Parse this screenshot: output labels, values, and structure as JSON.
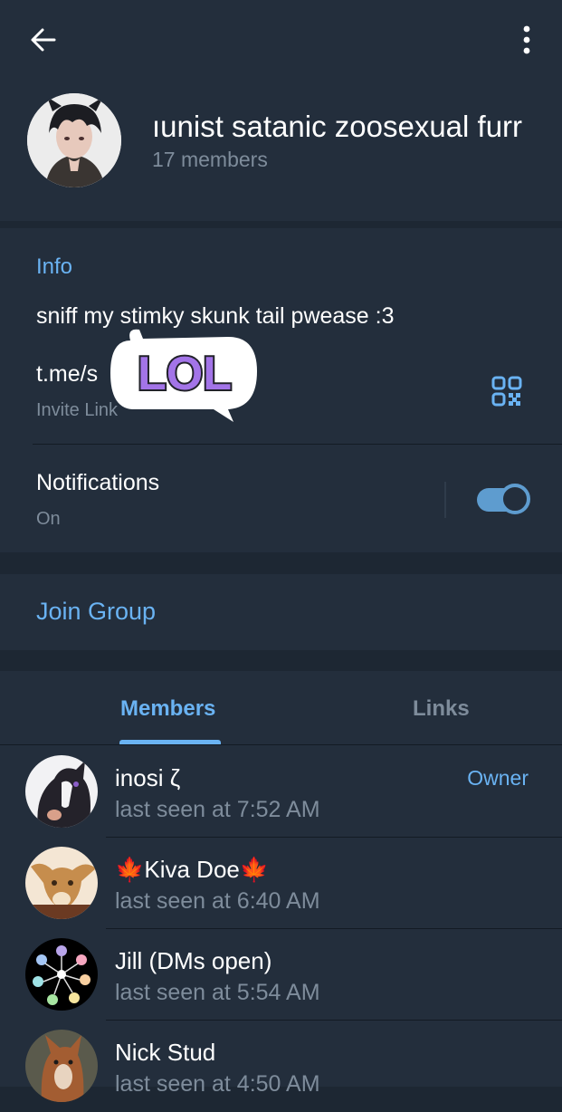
{
  "header": {
    "back_icon": "arrow-left-icon",
    "more_icon": "more-vertical-icon",
    "group_title": "ıunist satanic zoosexual furr",
    "member_count": "17 members"
  },
  "info": {
    "section_label": "Info",
    "description": "sniff my stimky skunk tail pwease :3",
    "invite_link": "t.me/s",
    "invite_caption": "Invite Link",
    "qr_icon": "qr-code-icon",
    "sticker_text": "LOL"
  },
  "notifications": {
    "label": "Notifications",
    "status": "On",
    "enabled": true
  },
  "join": {
    "label": "Join Group"
  },
  "tabs": [
    {
      "label": "Members",
      "active": true
    },
    {
      "label": "Links",
      "active": false
    }
  ],
  "members": [
    {
      "name": "inosi ζ",
      "status": "last seen at 7:52 AM",
      "role": "Owner"
    },
    {
      "name": "🍁Kiva Doe🍁",
      "status": "last seen at 6:40 AM",
      "role": ""
    },
    {
      "name": "Jill (DMs open)",
      "status": "last seen at 5:54 AM",
      "role": ""
    },
    {
      "name": "Nick Stud",
      "status": "last seen at 4:50 AM",
      "role": ""
    }
  ],
  "colors": {
    "accent": "#6ab3f3",
    "background": "#1d2733",
    "card": "#232e3c",
    "secondary_text": "#7e8c9b",
    "toggle": "#5e9ccf"
  }
}
